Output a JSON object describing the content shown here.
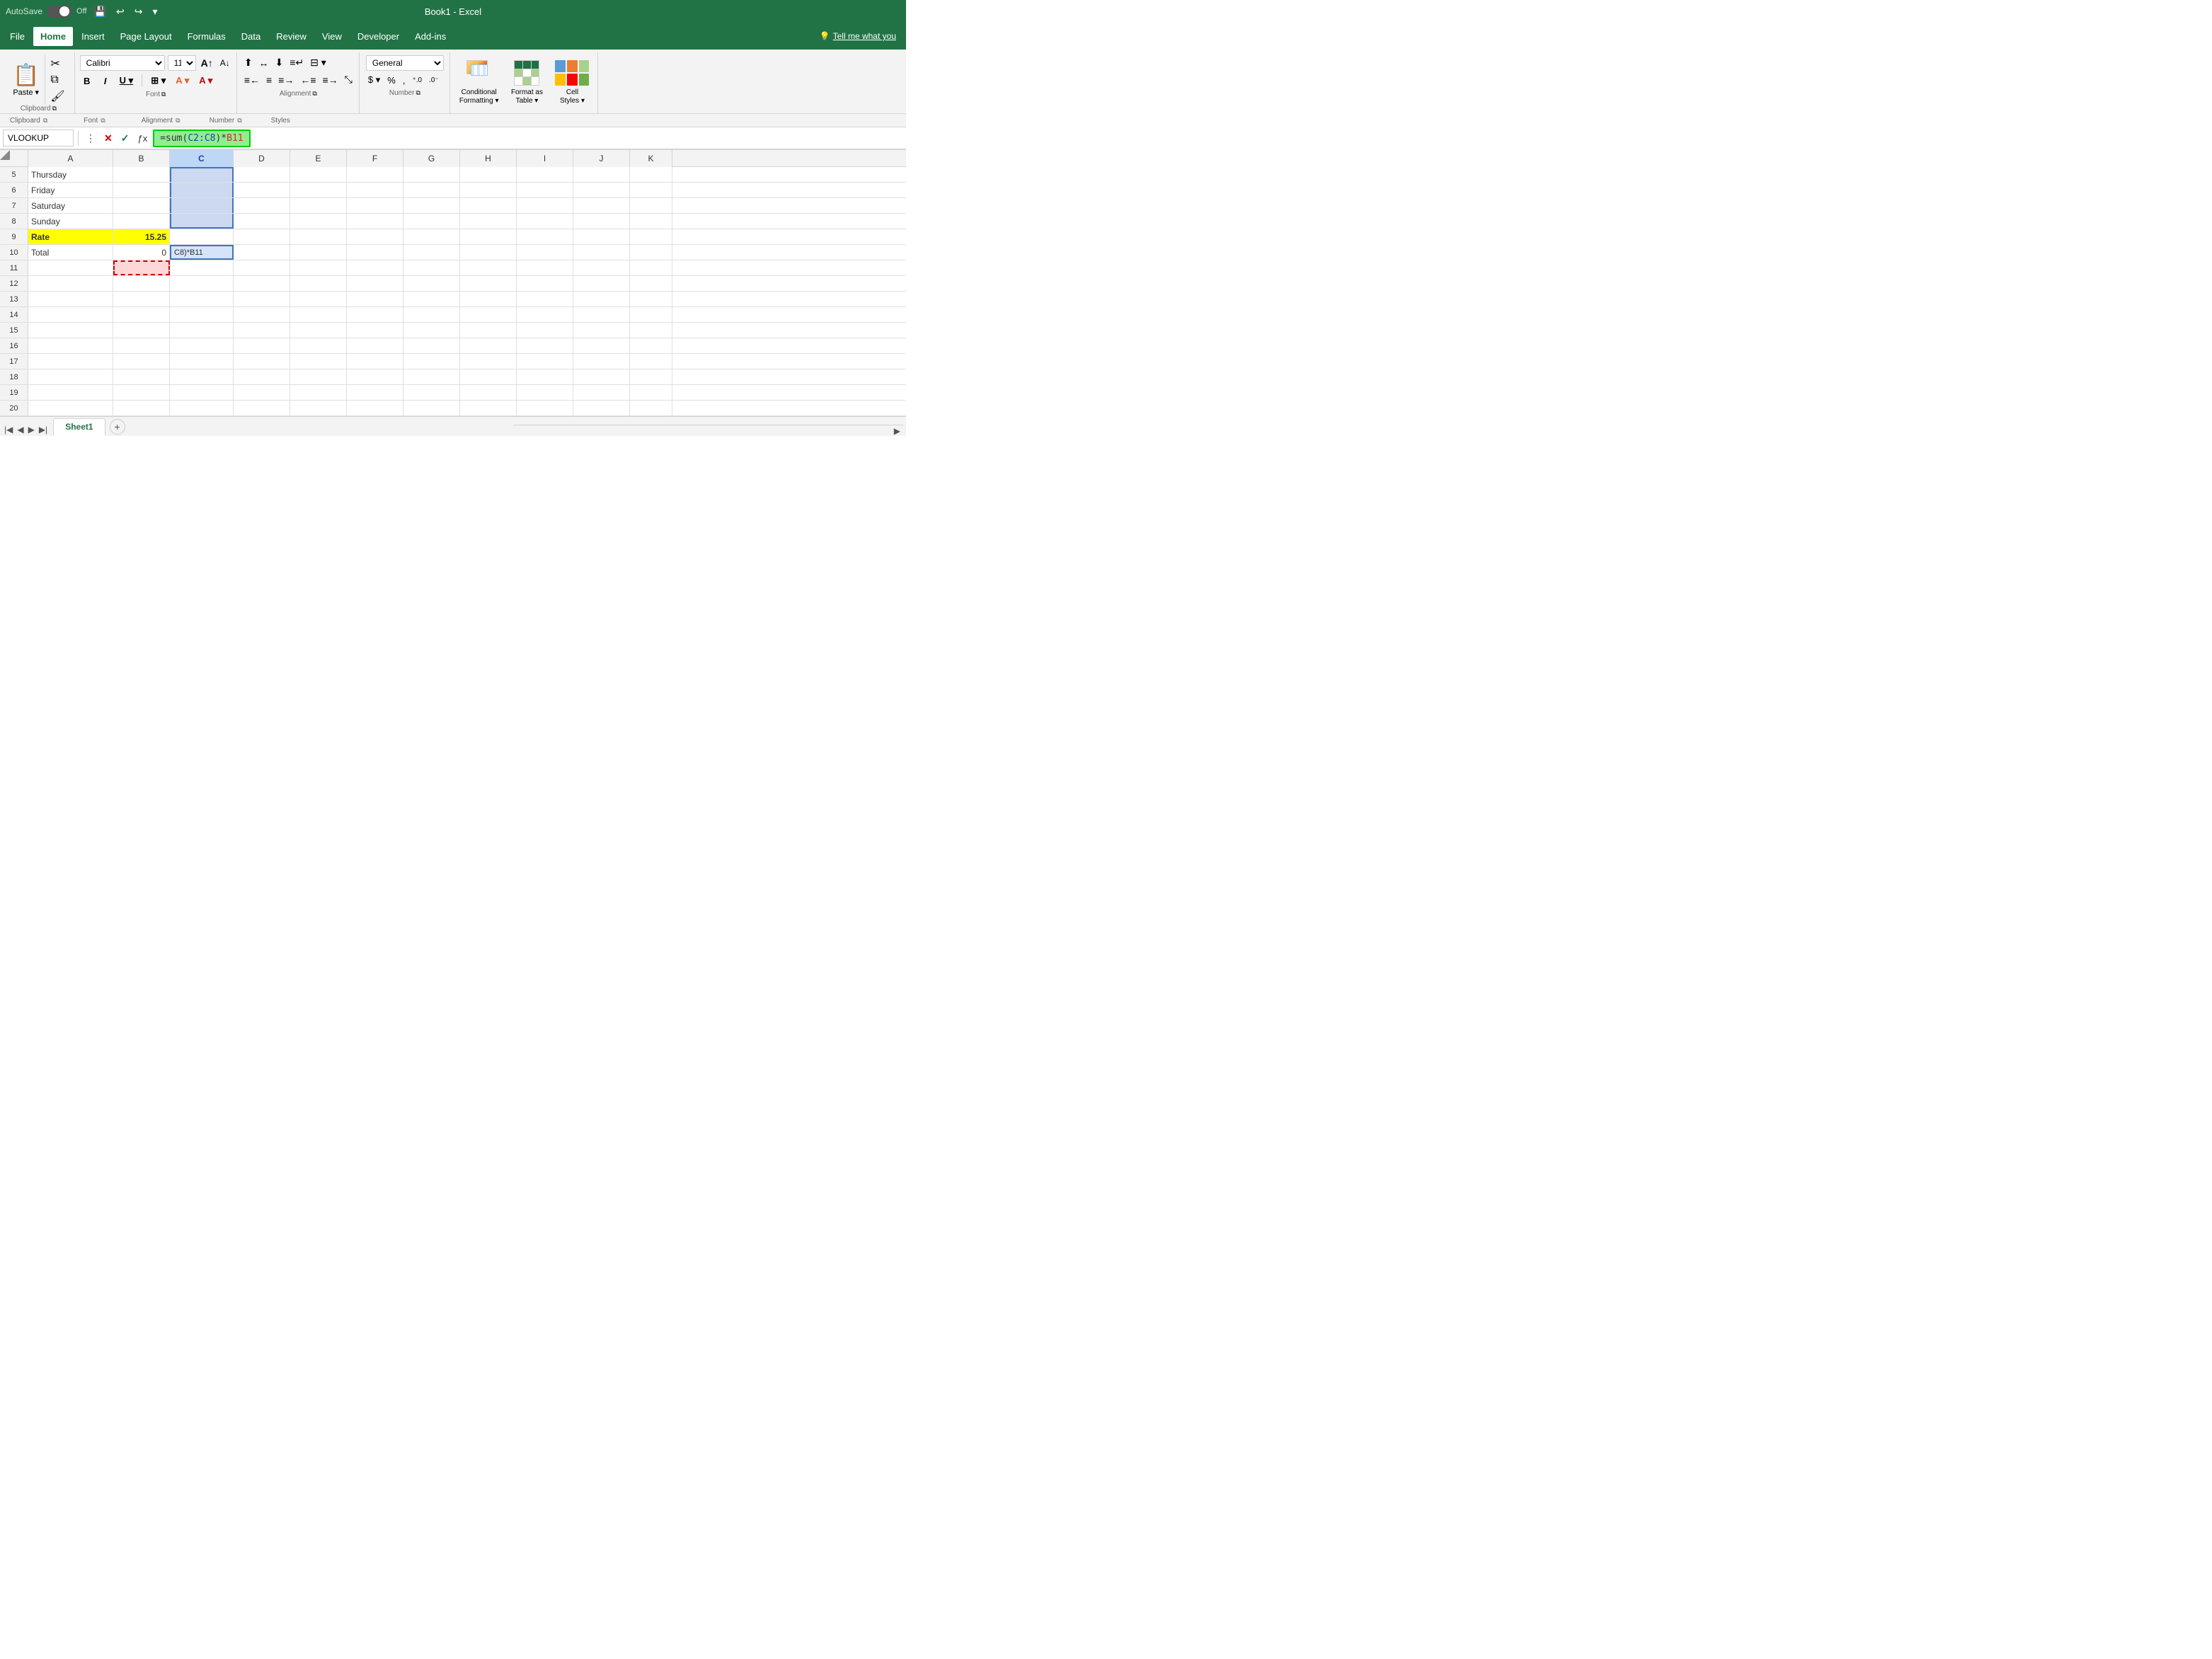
{
  "titlebar": {
    "autosave_label": "AutoSave",
    "autosave_state": "Off",
    "title": "Book1  -  Excel"
  },
  "menu": {
    "items": [
      "File",
      "Home",
      "Insert",
      "Page Layout",
      "Formulas",
      "Data",
      "Review",
      "View",
      "Developer",
      "Add-ins"
    ],
    "active": "Home",
    "tell_me": "Tell me what you"
  },
  "ribbon": {
    "clipboard": {
      "paste_label": "Paste",
      "cut_icon": "✂",
      "copy_icon": "⧉",
      "format_painter_icon": "🖌",
      "group_label": "Clipboard"
    },
    "font": {
      "font_name": "Calibri",
      "font_size": "11",
      "grow_icon": "A",
      "shrink_icon": "A",
      "bold": "B",
      "italic": "I",
      "underline": "U",
      "borders_icon": "⊞",
      "fill_icon": "A",
      "font_color_icon": "A",
      "group_label": "Font"
    },
    "alignment": {
      "group_label": "Alignment",
      "wrap_text": "≡"
    },
    "number": {
      "format_selector": "General",
      "dollar_icon": "$",
      "percent_icon": "%",
      "comma_icon": ",",
      "dec_inc": ".0",
      "dec_dec": ".00",
      "group_label": "Number"
    },
    "styles": {
      "conditional_label": "Conditional\nFormatting",
      "format_table_label": "Format as\nTable",
      "cell_styles_label": "Cell\nStyles",
      "group_label": "Styles"
    }
  },
  "formula_bar": {
    "name_box": "VLOOKUP",
    "formula_text": "=sum(C2:C8)*B11",
    "formula_part1": "=sum(",
    "formula_part2": "C2:C8",
    "formula_part3": ")*",
    "formula_part4": "B11"
  },
  "columns": [
    "A",
    "B",
    "C",
    "D",
    "E",
    "F",
    "G",
    "H",
    "I",
    "J",
    "K"
  ],
  "rows": [
    {
      "num": 5,
      "cells": {
        "A": "Thursday",
        "B": "",
        "C": "",
        "D": "",
        "E": "",
        "F": "",
        "G": "",
        "H": "",
        "I": "",
        "J": "",
        "K": ""
      }
    },
    {
      "num": 6,
      "cells": {
        "A": "Friday",
        "B": "",
        "C": "",
        "D": "",
        "E": "",
        "F": "",
        "G": "",
        "H": "",
        "I": "",
        "J": "",
        "K": ""
      }
    },
    {
      "num": 7,
      "cells": {
        "A": "Saturday",
        "B": "",
        "C": "",
        "D": "",
        "E": "",
        "F": "",
        "G": "",
        "H": "",
        "I": "",
        "J": "",
        "K": ""
      }
    },
    {
      "num": 8,
      "cells": {
        "A": "Sunday",
        "B": "",
        "C": "",
        "D": "",
        "E": "",
        "F": "",
        "G": "",
        "H": "",
        "I": "",
        "J": "",
        "K": ""
      }
    },
    {
      "num": 9,
      "cells": {
        "A": "Rate",
        "B": "15.25",
        "C": "",
        "D": "",
        "E": "",
        "F": "",
        "G": "",
        "H": "",
        "I": "",
        "J": "",
        "K": ""
      }
    },
    {
      "num": 10,
      "cells": {
        "A": "Total",
        "B": "0",
        "C": "C8)*B11",
        "D": "",
        "E": "",
        "F": "",
        "G": "",
        "H": "",
        "I": "",
        "J": "",
        "K": ""
      }
    },
    {
      "num": 11,
      "cells": {
        "A": "",
        "B": "",
        "C": "",
        "D": "",
        "E": "",
        "F": "",
        "G": "",
        "H": "",
        "I": "",
        "J": "",
        "K": ""
      }
    },
    {
      "num": 12,
      "cells": {
        "A": "",
        "B": "",
        "C": "",
        "D": "",
        "E": "",
        "F": "",
        "G": "",
        "H": "",
        "I": "",
        "J": "",
        "K": ""
      }
    },
    {
      "num": 13,
      "cells": {
        "A": "",
        "B": "",
        "C": "",
        "D": "",
        "E": "",
        "F": "",
        "G": "",
        "H": "",
        "I": "",
        "J": "",
        "K": ""
      }
    },
    {
      "num": 14,
      "cells": {
        "A": "",
        "B": "",
        "C": "",
        "D": "",
        "E": "",
        "F": "",
        "G": "",
        "H": "",
        "I": "",
        "J": "",
        "K": ""
      }
    },
    {
      "num": 15,
      "cells": {
        "A": "",
        "B": "",
        "C": "",
        "D": "",
        "E": "",
        "F": "",
        "G": "",
        "H": "",
        "I": "",
        "J": "",
        "K": ""
      }
    },
    {
      "num": 16,
      "cells": {
        "A": "",
        "B": "",
        "C": "",
        "D": "",
        "E": "",
        "F": "",
        "G": "",
        "H": "",
        "I": "",
        "J": "",
        "K": ""
      }
    },
    {
      "num": 17,
      "cells": {
        "A": "",
        "B": "",
        "C": "",
        "D": "",
        "E": "",
        "F": "",
        "G": "",
        "H": "",
        "I": "",
        "J": "",
        "K": ""
      }
    },
    {
      "num": 18,
      "cells": {
        "A": "",
        "B": "",
        "C": "",
        "D": "",
        "E": "",
        "F": "",
        "G": "",
        "H": "",
        "I": "",
        "J": "",
        "K": ""
      }
    },
    {
      "num": 19,
      "cells": {
        "A": "",
        "B": "",
        "C": "",
        "D": "",
        "E": "",
        "F": "",
        "G": "",
        "H": "",
        "I": "",
        "J": "",
        "K": ""
      }
    },
    {
      "num": 20,
      "cells": {
        "A": "",
        "B": "",
        "C": "",
        "D": "",
        "E": "",
        "F": "",
        "G": "",
        "H": "",
        "I": "",
        "J": "",
        "K": ""
      }
    }
  ],
  "sheet_tabs": [
    "Sheet1"
  ],
  "active_sheet": "Sheet1",
  "colors": {
    "excel_green": "#217346",
    "header_bg": "#f3f3f3",
    "selected_col_bg": "#bdd7f5",
    "yellow_cell": "#ffff00",
    "red_border": "#cc0000",
    "formula_green": "#90ee90"
  }
}
